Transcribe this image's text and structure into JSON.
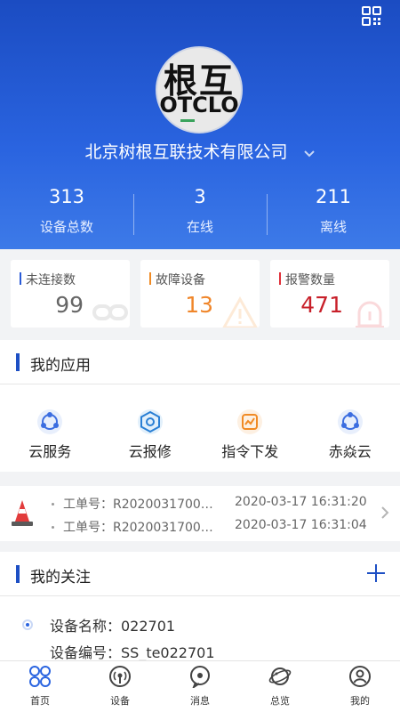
{
  "header": {
    "logo_top": "根互",
    "logo_bottom": "OTCLO",
    "company": "北京树根互联技术有限公司",
    "stats": [
      {
        "value": "313",
        "label": "设备总数"
      },
      {
        "value": "3",
        "label": "在线"
      },
      {
        "value": "211",
        "label": "离线"
      }
    ]
  },
  "cards": [
    {
      "label": "未连接数",
      "value": "99",
      "accent": "#2a5bd7"
    },
    {
      "label": "故障设备",
      "value": "13",
      "accent": "#f08a24"
    },
    {
      "label": "报警数量",
      "value": "471",
      "accent": "#e0303a"
    }
  ],
  "apps": {
    "title": "我的应用",
    "items": [
      {
        "label": "云服务",
        "icon": "cloud-service-icon"
      },
      {
        "label": "云报修",
        "icon": "cloud-repair-icon"
      },
      {
        "label": "指令下发",
        "icon": "command-issue-icon"
      },
      {
        "label": "赤焱云",
        "icon": "chiyan-cloud-icon"
      }
    ]
  },
  "orders": [
    {
      "no": "工单号：R2020031700…",
      "time": "2020-03-17 16:31:20"
    },
    {
      "no": "工单号：R2020031700…",
      "time": "2020-03-17 16:31:04"
    }
  ],
  "follow": {
    "title": "我的关注",
    "device_name": "设备名称：022701",
    "device_code": "设备编号：SS_te022701"
  },
  "tabs": [
    {
      "label": "首页",
      "icon": "home-icon"
    },
    {
      "label": "设备",
      "icon": "device-icon"
    },
    {
      "label": "消息",
      "icon": "message-icon"
    },
    {
      "label": "总览",
      "icon": "overview-icon"
    },
    {
      "label": "我的",
      "icon": "profile-icon"
    }
  ],
  "colors": {
    "brand_blue": "#2a64e0",
    "warning_orange": "#f0862a",
    "alarm_red": "#c8202a"
  }
}
